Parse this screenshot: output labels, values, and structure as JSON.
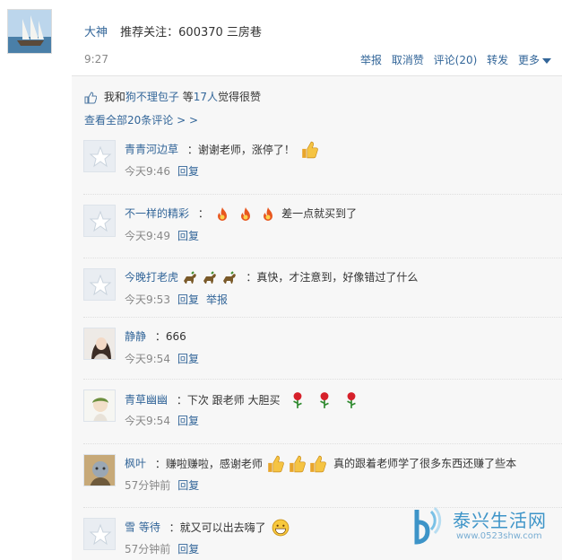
{
  "post": {
    "author": "大神",
    "content": "推荐关注：600370 三房巷",
    "time": "9:27"
  },
  "actions": {
    "report": "举报",
    "unlike": "取消赞",
    "comments": "评论(20)",
    "forward": "转发",
    "more": "更多"
  },
  "likes": {
    "prefix": "我和",
    "user": "狗不理包子",
    "middle": "等",
    "count": "17人",
    "suffix": "觉得很赞"
  },
  "view_all": "查看全部20条评论 > >",
  "comments": [
    {
      "name": "青青河边草",
      "text": "：谢谢老师，涨停了！",
      "time": "今天9:46",
      "reply": "回复",
      "report": ""
    },
    {
      "name": "不一样的精彩",
      "text": "差一点就买到了",
      "time": "今天9:49",
      "reply": "回复",
      "report": ""
    },
    {
      "name": "今晚打老虎",
      "text": "：真快，才注意到，好像错过了什么",
      "time": "今天9:53",
      "reply": "回复",
      "report": "举报"
    },
    {
      "name": "静静",
      "text": "：666",
      "time": "今天9:54",
      "reply": "回复",
      "report": ""
    },
    {
      "name": "青草幽幽",
      "text": "：下次 跟老师 大胆买",
      "time": "今天9:54",
      "reply": "回复",
      "report": ""
    },
    {
      "name": "枫叶",
      "text": "：赚啦赚啦，感谢老师",
      "text2": "真的跟着老师学了很多东西还赚了些本",
      "time": "57分钟前",
      "reply": "回复",
      "report": ""
    },
    {
      "name": "雪 等待",
      "text": "：就又可以出去嗨了",
      "time": "57分钟前",
      "reply": "回复",
      "report": ""
    }
  ],
  "watermark": {
    "title": "泰兴生活网",
    "url": "www.0523shw.com"
  },
  "colors": {
    "link": "#336699",
    "panel_bg": "#f7f7f7",
    "watermark": "#3d94c8"
  }
}
